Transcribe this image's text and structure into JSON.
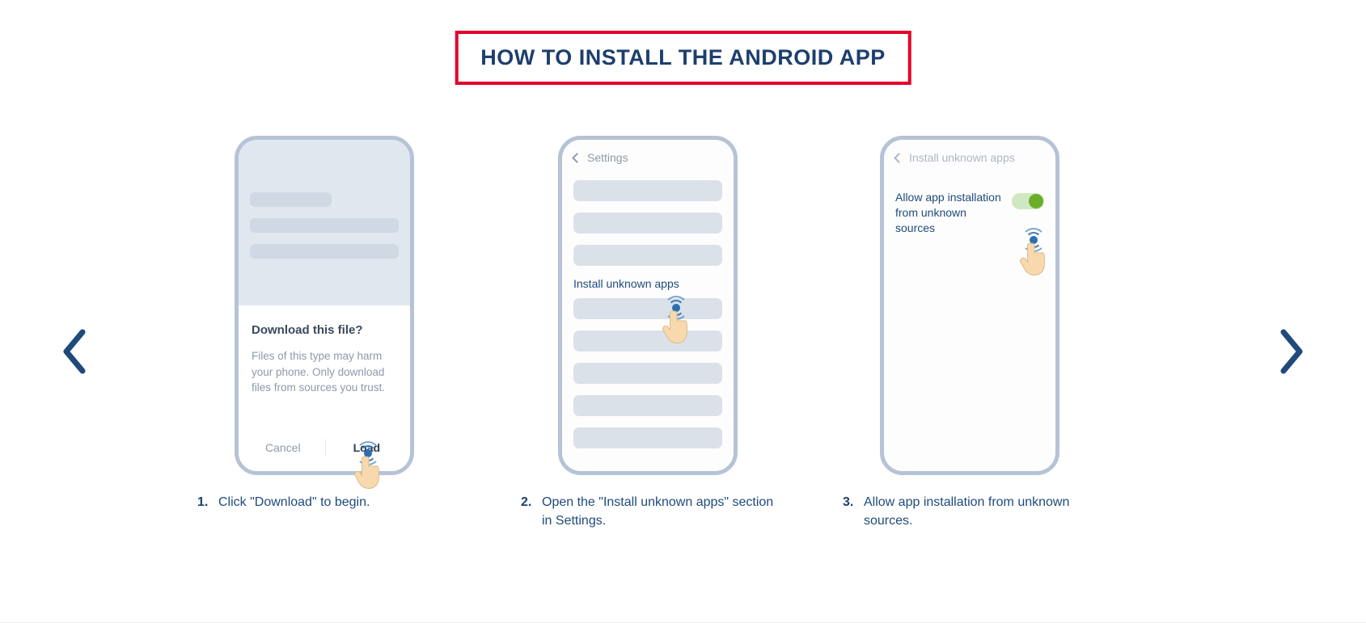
{
  "title": "HOW TO INSTALL THE ANDROID APP",
  "steps": [
    {
      "number": "1.",
      "caption": "Click \"Download\" to begin.",
      "dialog_title": "Download this file?",
      "dialog_body": "Files of this type may harm your phone. Only download files from sources you trust.",
      "cancel_label": "Cancel",
      "load_label": "Load"
    },
    {
      "number": "2.",
      "caption": "Open the \"Install unknown apps\" section in Settings.",
      "header_label": "Settings",
      "item_label": "Install unknown apps"
    },
    {
      "number": "3.",
      "caption": "Allow app installation from unknown sources.",
      "header_label": "Install unknown apps",
      "setting_label": "Allow app installation from unknown sources"
    }
  ]
}
